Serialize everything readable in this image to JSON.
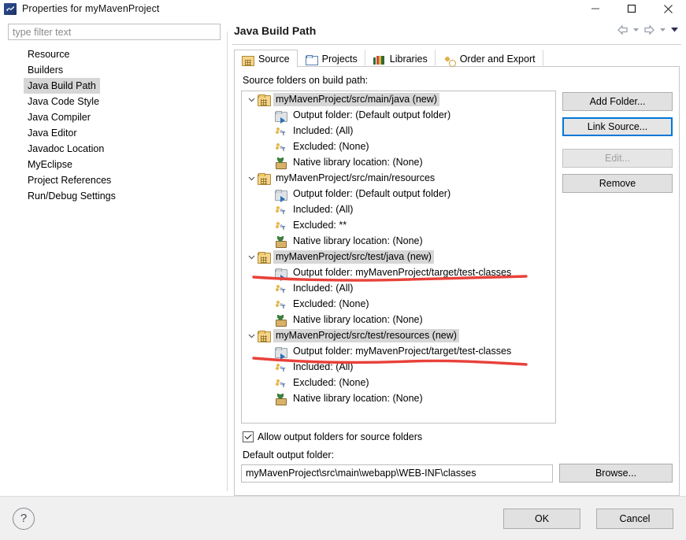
{
  "window": {
    "title": "Properties for myMavenProject",
    "app_icon": "eclipse-icon",
    "minimize": "minimize-icon",
    "maximize": "maximize-icon",
    "close": "close-icon"
  },
  "sidebar": {
    "filter_placeholder": "type filter text",
    "items": [
      {
        "label": "Resource",
        "selected": false
      },
      {
        "label": "Builders",
        "selected": false
      },
      {
        "label": "Java Build Path",
        "selected": true
      },
      {
        "label": "Java Code Style",
        "selected": false
      },
      {
        "label": "Java Compiler",
        "selected": false
      },
      {
        "label": "Java Editor",
        "selected": false
      },
      {
        "label": "Javadoc Location",
        "selected": false
      },
      {
        "label": "MyEclipse",
        "selected": false
      },
      {
        "label": "Project References",
        "selected": false
      },
      {
        "label": "Run/Debug Settings",
        "selected": false
      }
    ]
  },
  "page": {
    "title": "Java Build Path",
    "nav": {
      "back": "back-arrow-icon",
      "back_menu": "chevron-down-icon",
      "forward": "forward-arrow-icon",
      "forward_menu": "chevron-down-icon",
      "view_menu": "chevron-down-icon"
    },
    "tabs": [
      {
        "label": "Source",
        "icon": "source-folder-icon",
        "active": true
      },
      {
        "label": "Projects",
        "icon": "project-folder-icon",
        "active": false
      },
      {
        "label": "Libraries",
        "icon": "libraries-icon",
        "active": false
      },
      {
        "label": "Order and Export",
        "icon": "order-export-icon",
        "active": false
      }
    ],
    "tree_label": "Source folders on build path:",
    "tree": [
      {
        "root": "myMavenProject/src/main/java (new)",
        "selected": true,
        "expanded": true,
        "children": [
          {
            "icon": "output-folder-icon",
            "label": "Output folder: (Default output folder)"
          },
          {
            "icon": "inclusion-filter-icon",
            "label": "Included: (All)"
          },
          {
            "icon": "exclusion-filter-icon",
            "label": "Excluded: (None)"
          },
          {
            "icon": "native-library-icon",
            "label": "Native library location: (None)"
          }
        ]
      },
      {
        "root": "myMavenProject/src/main/resources",
        "selected": false,
        "expanded": true,
        "children": [
          {
            "icon": "output-folder-icon",
            "label": "Output folder: (Default output folder)"
          },
          {
            "icon": "inclusion-filter-icon",
            "label": "Included: (All)"
          },
          {
            "icon": "exclusion-filter-icon",
            "label": "Excluded: **"
          },
          {
            "icon": "native-library-icon",
            "label": "Native library location: (None)"
          }
        ]
      },
      {
        "root": "myMavenProject/src/test/java (new)",
        "selected": true,
        "expanded": true,
        "children": [
          {
            "icon": "output-folder-icon",
            "label": "Output folder: myMavenProject/target/test-classes"
          },
          {
            "icon": "inclusion-filter-icon",
            "label": "Included: (All)"
          },
          {
            "icon": "exclusion-filter-icon",
            "label": "Excluded: (None)"
          },
          {
            "icon": "native-library-icon",
            "label": "Native library location: (None)"
          }
        ]
      },
      {
        "root": "myMavenProject/src/test/resources (new)",
        "selected": true,
        "expanded": true,
        "children": [
          {
            "icon": "output-folder-icon",
            "label": "Output folder: myMavenProject/target/test-classes"
          },
          {
            "icon": "inclusion-filter-icon",
            "label": "Included: (All)"
          },
          {
            "icon": "exclusion-filter-icon",
            "label": "Excluded: (None)"
          },
          {
            "icon": "native-library-icon",
            "label": "Native library location: (None)"
          }
        ]
      }
    ],
    "buttons": {
      "add_folder": "Add Folder...",
      "link_source": "Link Source...",
      "edit": "Edit...",
      "remove": "Remove"
    },
    "allow_output_checkbox": {
      "label": "Allow output folders for source folders",
      "checked": true
    },
    "default_output": {
      "label": "Default output folder:",
      "value": "myMavenProject\\src\\main\\webapp\\WEB-INF\\classes",
      "browse": "Browse..."
    }
  },
  "footer": {
    "help": "?",
    "ok": "OK",
    "cancel": "Cancel"
  },
  "annotations": {
    "underline_color": "#e8413a",
    "marks": [
      "red-underline-test-java-output",
      "red-underline-test-resources-output"
    ]
  },
  "colors": {
    "focus_blue": "#0078d7",
    "selection_gray": "#d6d6d6",
    "button_face": "#e1e1e1",
    "footer_bg": "#f0f0f0"
  }
}
